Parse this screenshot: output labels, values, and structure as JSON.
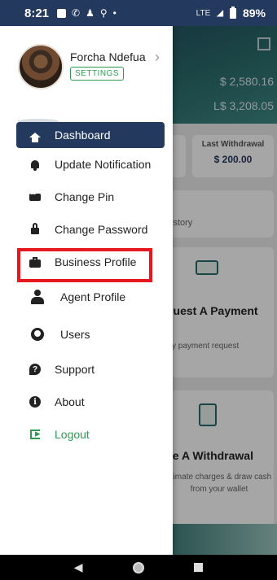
{
  "status_bar": {
    "time": "8:21",
    "network": "LTE",
    "battery": "89%",
    "icons": [
      "gallery-icon",
      "whatsapp-icon",
      "activity-icon",
      "link-icon",
      "dot-icon"
    ]
  },
  "background_app": {
    "balance_primary": "$ 2,580.16",
    "balance_secondary": "L$ 3,208.05",
    "last_withdrawal_label": "Last Withdrawal",
    "last_withdrawal_value": "$ 200.00",
    "history_fragment": "istory",
    "request_heading": "quest A Payment",
    "request_desc": "sy payment request",
    "withdrawal_heading": "ke A Withdrawal",
    "withdrawal_desc": "stimate charges & draw cash from your wallet"
  },
  "drawer": {
    "user_name": "Forcha Ndefua",
    "settings_label": "SETTINGS",
    "items": [
      {
        "label": "Dashboard",
        "icon": "home-icon",
        "active": true
      },
      {
        "label": "Update Notification",
        "icon": "bell-icon"
      },
      {
        "label": "Change Pin",
        "icon": "pin-icon"
      },
      {
        "label": "Change Password",
        "icon": "lock-icon"
      },
      {
        "label": "Business Profile",
        "icon": "briefcase-icon"
      },
      {
        "label": "Agent Profile",
        "icon": "agent-icon"
      },
      {
        "label": "Users",
        "icon": "users-icon"
      },
      {
        "label": "Support",
        "icon": "support-icon"
      },
      {
        "label": "About",
        "icon": "info-icon"
      },
      {
        "label": "Logout",
        "icon": "logout-icon"
      }
    ],
    "highlighted_item": "Business Profile"
  },
  "colors": {
    "primary": "#23395d",
    "accent_green": "#2e9a52",
    "highlight_red": "#e4181e"
  }
}
